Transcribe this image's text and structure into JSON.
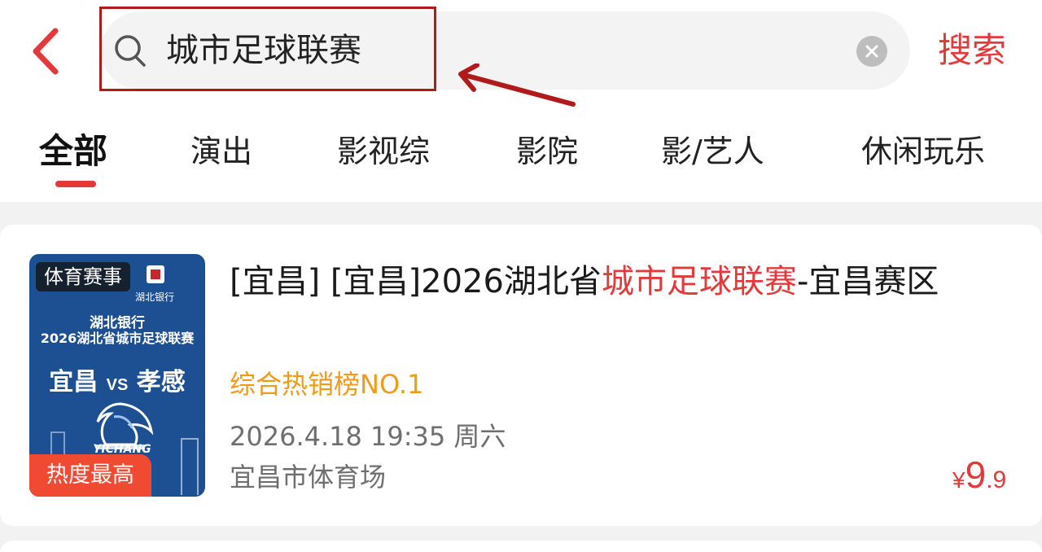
{
  "search": {
    "query": "城市足球联赛",
    "submit_label": "搜索"
  },
  "tabs": [
    {
      "label": "全部"
    },
    {
      "label": "演出"
    },
    {
      "label": "影视综"
    },
    {
      "label": "影院"
    },
    {
      "label": "影/艺人"
    },
    {
      "label": "休闲玩乐"
    }
  ],
  "result": {
    "poster": {
      "category_tag": "体育赛事",
      "sponsor": "湖北银行",
      "line1": "湖北银行",
      "line2": "2026湖北省城市足球联赛",
      "home": "宜昌",
      "vs": "VS",
      "away": "孝感",
      "team_text": "YICHANG",
      "hot_badge": "热度最高"
    },
    "title_prefix": "[宜昌] [宜昌]2026湖北省",
    "title_keyword": "城市足球联赛",
    "title_suffix": "-宜昌赛区",
    "rank": "综合热销榜NO.1",
    "datetime": "2026.4.18 19:35 周六",
    "venue": "宜昌市体育场",
    "price": {
      "currency": "¥",
      "integer": "9",
      "decimal": ".9"
    }
  },
  "colors": {
    "accent": "#e23a3a",
    "rank": "#f09a18",
    "annotation": "#b11a1a"
  }
}
